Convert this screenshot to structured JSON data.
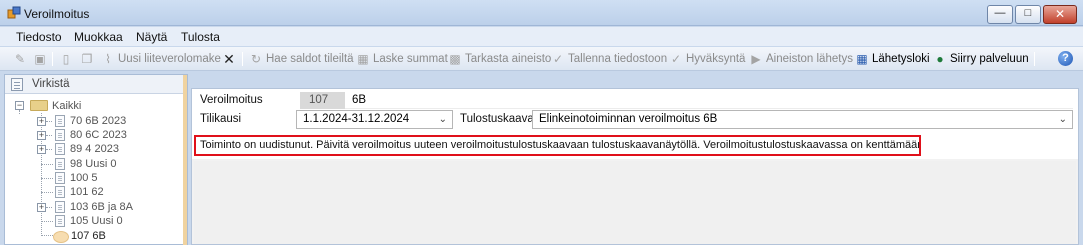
{
  "window": {
    "title": "Veroilmoitus",
    "buttons": {
      "minimize": "—",
      "maximize": "□",
      "close": "✕"
    }
  },
  "menu": [
    "Tiedosto",
    "Muokkaa",
    "Näytä",
    "Tulosta"
  ],
  "toolbar": {
    "new_attachment": "Uusi liiteverolomake",
    "fetch_balances": "Hae saldot tileiltä",
    "calculate_sums": "Laske summat",
    "check_material": "Tarkasta aineisto",
    "save_file": "Tallenna tiedostoon",
    "approve": "Hyväksyntä",
    "send_material": "Aineiston lähetys",
    "send_log": "Lähetysloki",
    "go_service": "Siirry palveluun"
  },
  "sidebar": {
    "title": "Virkistä",
    "root": "Kaikki",
    "items": [
      {
        "label": "70 6B 2023",
        "expandable": true
      },
      {
        "label": "80 6C 2023",
        "expandable": true
      },
      {
        "label": "89 4 2023",
        "expandable": true
      },
      {
        "label": "98 Uusi 0",
        "expandable": false
      },
      {
        "label": "100 5",
        "expandable": false
      },
      {
        "label": "101 62",
        "expandable": false
      },
      {
        "label": "103 6B ja 8A",
        "expandable": true
      },
      {
        "label": "105 Uusi 0",
        "expandable": false
      },
      {
        "label": "107 6B",
        "expandable": false,
        "selected": true
      }
    ]
  },
  "form": {
    "veroilmoitus_label": "Veroilmoitus",
    "veroilmoitus_id": "107",
    "veroilmoitus_type": "6B",
    "tilikausi_label": "Tilikausi",
    "tilikausi_value": "1.1.2024-31.12.2024",
    "tulostuskaava_label": "Tulostuskaava",
    "tulostuskaava_value": "Elinkeinotoiminnan veroilmoitus 6B",
    "warning": "Toiminto on uudistunut. Päivitä veroilmoitus uuteen veroilmoitustulostuskaavaan tulostuskaavanäytöllä.  Veroilmoitustulostuskaavassa on kenttämäärityksiä kenttien alla."
  },
  "colors": {
    "warning_border": "#e0101a",
    "titlebar": "#cfdff3",
    "selection": "#f7ddb0"
  }
}
